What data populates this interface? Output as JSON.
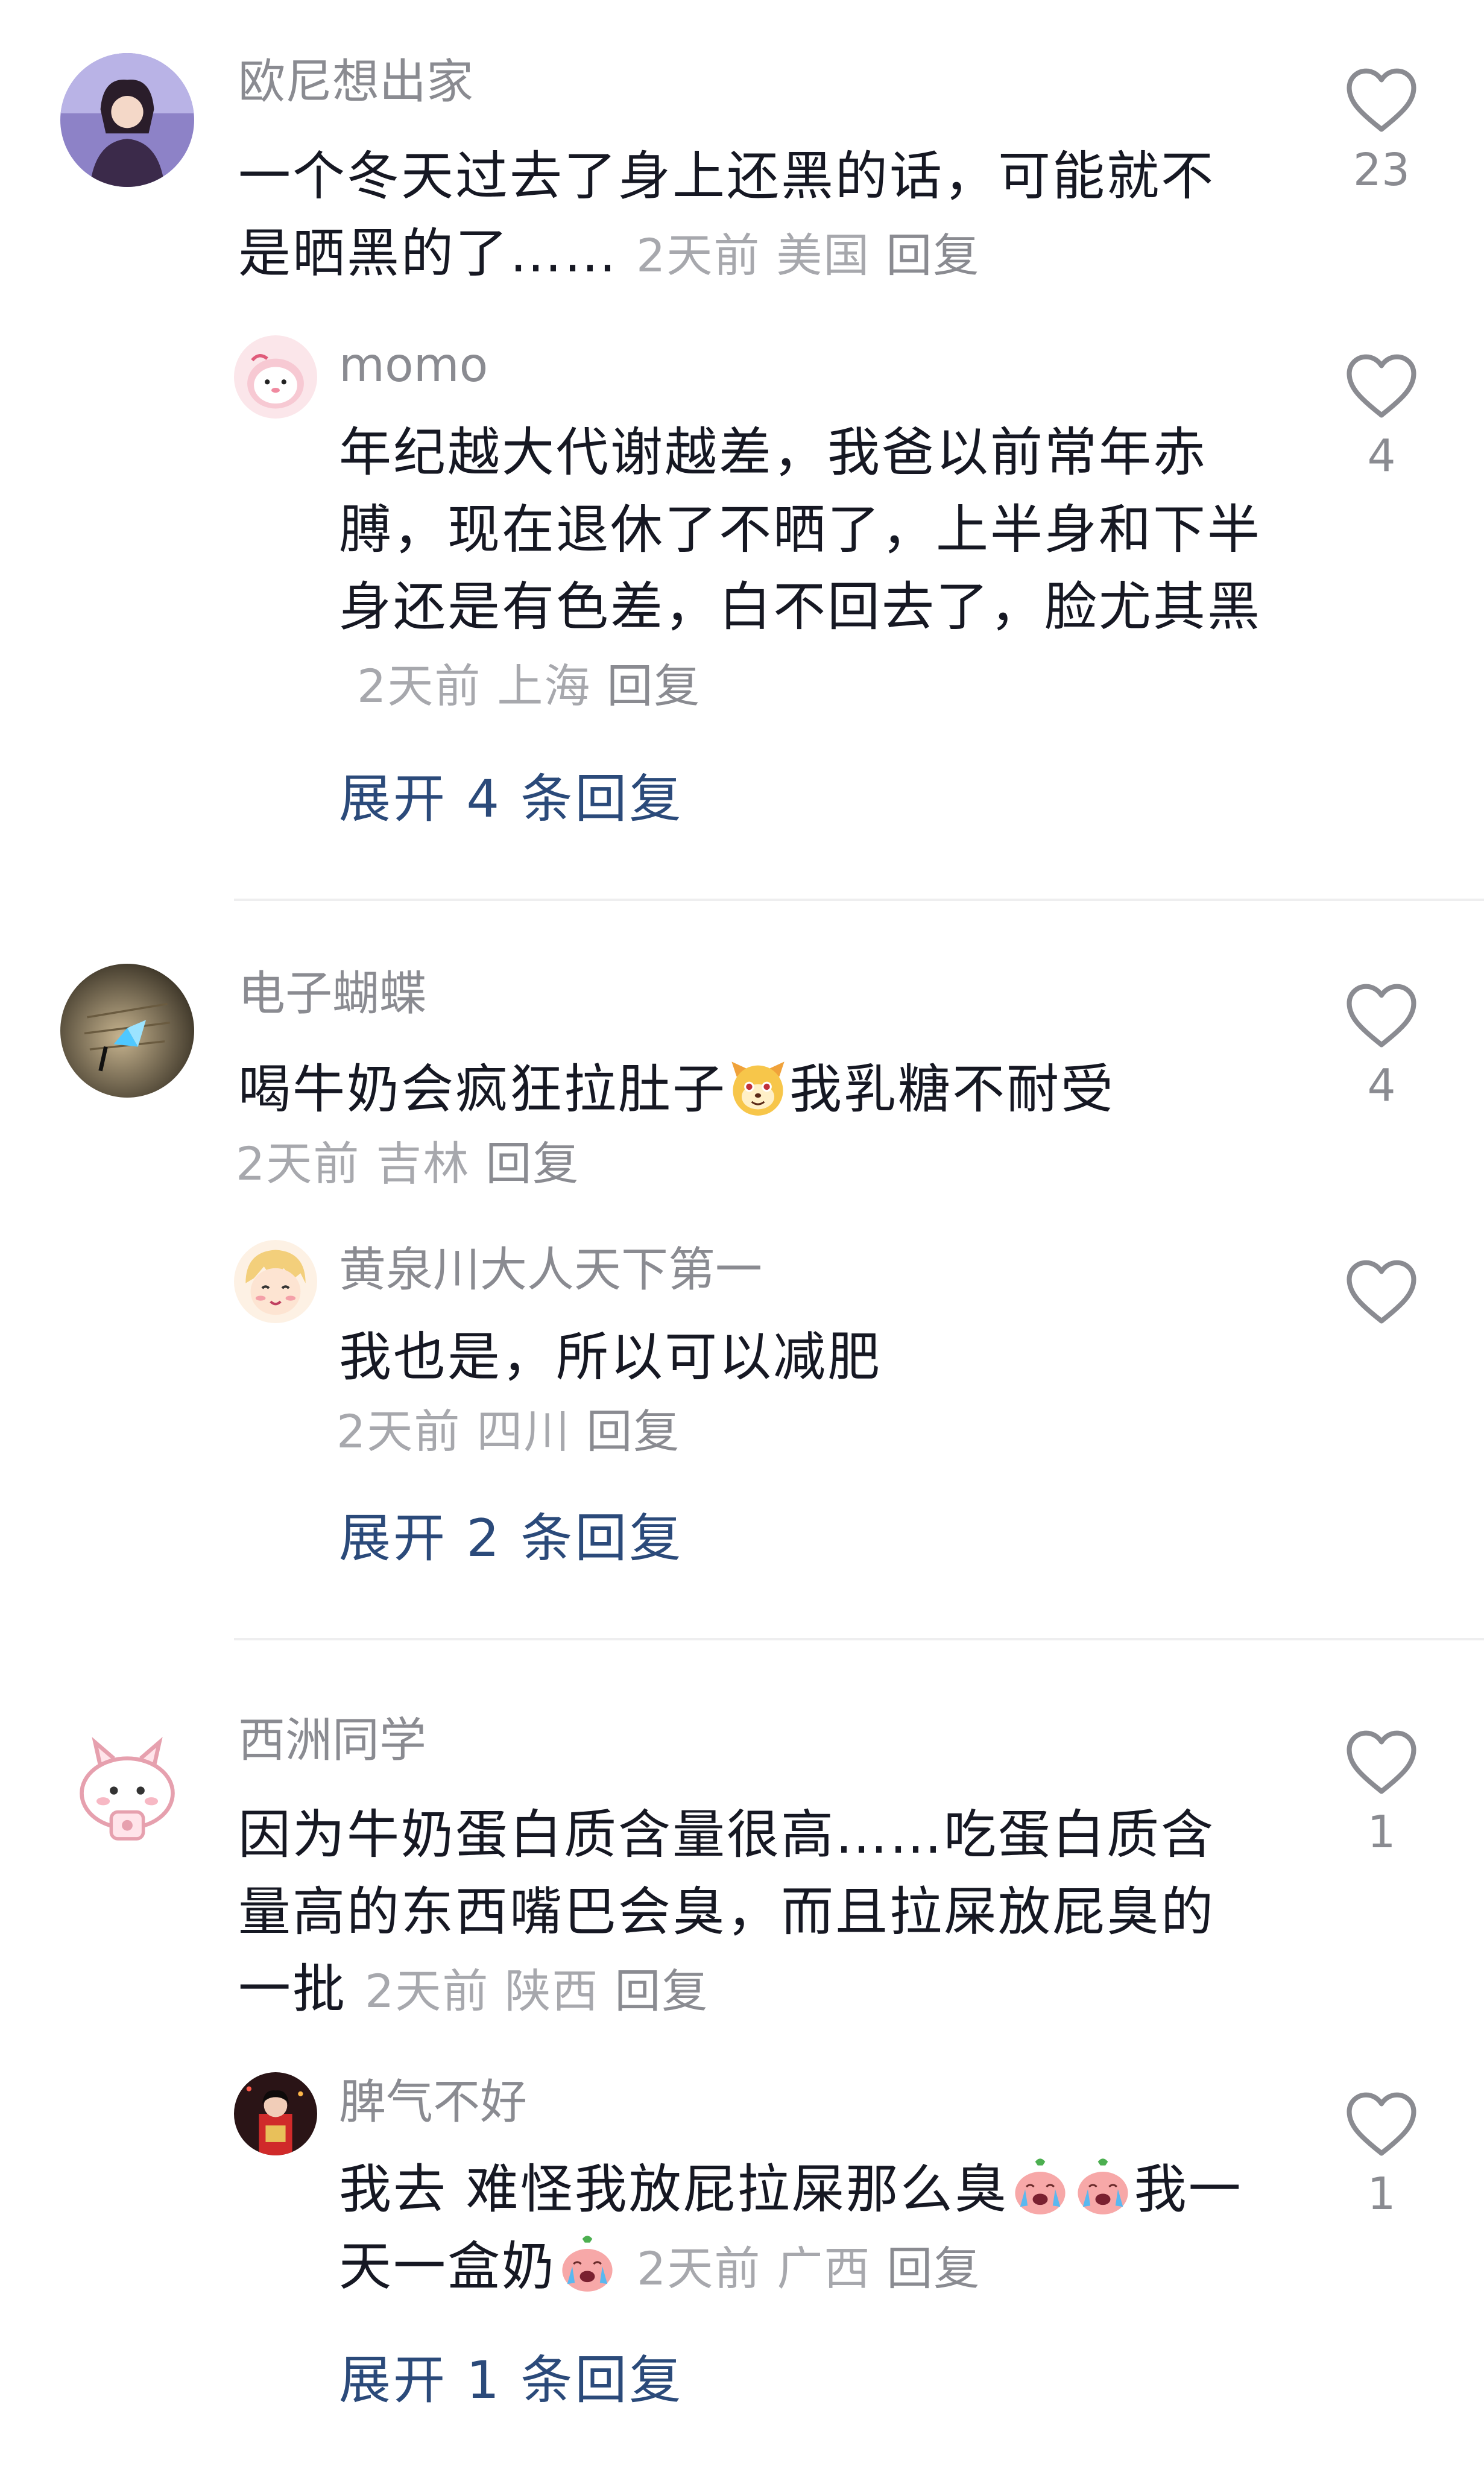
{
  "comments": [
    {
      "nickname": "欧尼想出家",
      "text": "一个冬天过去了身上还黑的话，可能就不是晒黑的了……",
      "time": "2天前",
      "location": "美国",
      "reply_label": "回复",
      "likes": "23",
      "replies": [
        {
          "nickname": "momo",
          "text": "年纪越大代谢越差，我爸以前常年赤膊，现在退休了不晒了，上半身和下半身还是有色差，白不回去了，脸尤其黑",
          "time": "2天前",
          "location": "上海",
          "reply_label": "回复",
          "likes": "4"
        }
      ],
      "expand_label": "展开 4 条回复"
    },
    {
      "nickname": "电子蝴蝶",
      "text_before_emoji": "喝牛奶会疯狂拉肚子",
      "text_after_emoji": "我乳糖不耐受",
      "emoji": "dog-face-emoji",
      "time": "2天前",
      "location": "吉林",
      "reply_label": "回复",
      "likes": "4",
      "replies": [
        {
          "nickname": "黄泉川大人天下第一",
          "text": "我也是，所以可以减肥",
          "time": "2天前",
          "location": "四川",
          "reply_label": "回复",
          "likes": ""
        }
      ],
      "expand_label": "展开 2 条回复"
    },
    {
      "nickname": "西洲同学",
      "text": "因为牛奶蛋白质含量很高……吃蛋白质含量高的东西嘴巴会臭，而且拉屎放屁臭的一批",
      "time": "2天前",
      "location": "陕西",
      "reply_label": "回复",
      "likes": "1",
      "replies": [
        {
          "nickname": "脾气不好",
          "text_part1": "我去 难怪我放屁拉屎那么臭",
          "text_part2": "我一天一盒奶",
          "emoji": "crying-emoji",
          "time": "2天前",
          "location": "广西",
          "reply_label": "回复",
          "likes": "1"
        }
      ],
      "expand_label": "展开 1 条回复"
    }
  ],
  "colors": {
    "nickname": "#8a8b91",
    "text": "#161823",
    "meta": "#a7a8ad",
    "expand": "#2b4a7a",
    "divider": "#eeeeef"
  }
}
